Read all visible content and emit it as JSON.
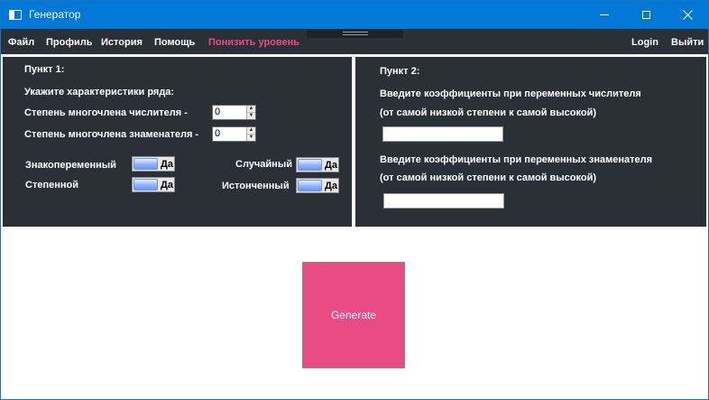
{
  "window": {
    "title": "Генератор"
  },
  "menu": {
    "items": [
      "Файл",
      "Профиль",
      "История",
      "Помощь",
      "Понизить уровень"
    ],
    "right_items": [
      "Login",
      "Выйти"
    ],
    "accent_color": "#e94c85"
  },
  "section1": {
    "heading": "Пункт 1:",
    "subheading": "Укажите характеристики ряда:",
    "numerator_label": "Степень многочлена числителя -",
    "numerator_value": "0",
    "denominator_label": "Степень многочлена знаменателя -",
    "denominator_value": "0",
    "toggles": [
      {
        "label": "Знакопеременный",
        "state": "Да"
      },
      {
        "label": "Случайный",
        "state": "Да"
      },
      {
        "label": "Степенной",
        "state": "Да"
      },
      {
        "label": "Истонченный",
        "state": "Да"
      }
    ]
  },
  "section2": {
    "heading": "Пункт 2:",
    "numerator_prompt": "Введите коэффициенты при переменных числителя",
    "numerator_hint": "(от самой низкой степени к самой высокой)",
    "numerator_value": "",
    "denominator_prompt": "Введите коэффициенты при переменных знаменателя",
    "denominator_hint": "(от самой низкой степени к самой высокой)",
    "denominator_value": ""
  },
  "generate_button": {
    "label": "Generate",
    "color": "#e94c85"
  },
  "colors": {
    "titlebar": "#0078d7",
    "panel": "#2b2f36"
  }
}
